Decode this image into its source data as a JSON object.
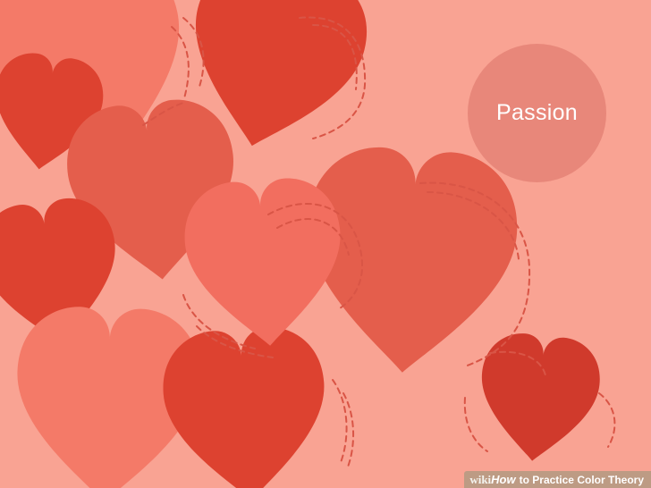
{
  "colors": {
    "background": "#F9A393",
    "heart_salmon": "#F47A68",
    "heart_red": "#DD4230",
    "heart_crimson": "#D03A2C",
    "heart_coral": "#E45E4C",
    "heart_light": "#F26E5F",
    "dash_line": "#D95546",
    "passion_circle": "#E8877A",
    "passion_text": "#FFFFFF"
  },
  "label": {
    "text": "Passion"
  },
  "watermark": {
    "brand": "wiki",
    "how": "How",
    "title": "to Practice Color Theory"
  },
  "icons": [
    "heart-icon"
  ]
}
